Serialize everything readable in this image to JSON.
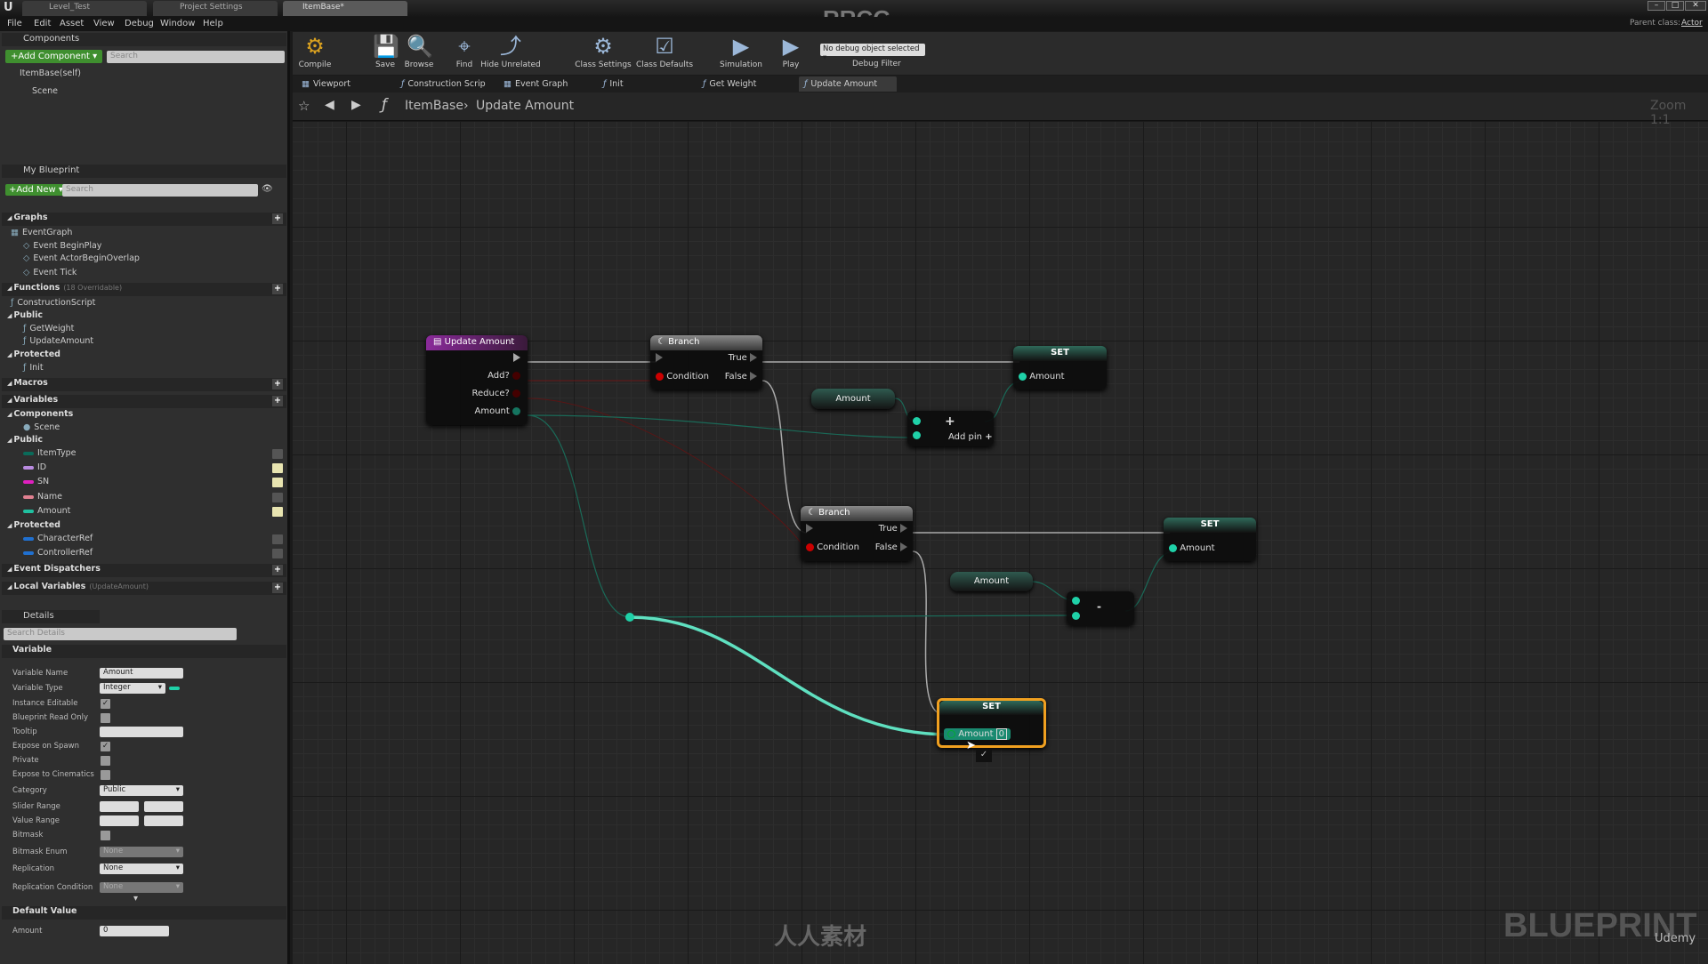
{
  "app": {
    "watermark_title": "RRCG",
    "doc_tabs": [
      "Level_Test",
      "Project Settings",
      "ItemBase*"
    ],
    "menu": [
      "File",
      "Edit",
      "Asset",
      "View",
      "Debug",
      "Window",
      "Help"
    ],
    "parent_class_label": "Parent class:",
    "parent_class": "Actor",
    "window_buttons": [
      "–",
      "□",
      "✕"
    ]
  },
  "components": {
    "title": "Components",
    "add_label": "+Add Component ▾",
    "search_placeholder": "Search",
    "items": [
      "ItemBase(self)",
      "Scene"
    ]
  },
  "my_blueprint": {
    "title": "My Blueprint",
    "add_label": "+Add New ▾",
    "search_placeholder": "Search",
    "rows": [
      {
        "t": "cat",
        "label": "Graphs",
        "plus": true
      },
      {
        "t": "item",
        "label": "EventGraph",
        "indent": 0,
        "icon": "graph-icon"
      },
      {
        "t": "item",
        "label": "Event BeginPlay",
        "indent": 1,
        "icon": "event-icon"
      },
      {
        "t": "item",
        "label": "Event ActorBeginOverlap",
        "indent": 1,
        "icon": "event-icon"
      },
      {
        "t": "item",
        "label": "Event Tick",
        "indent": 1,
        "icon": "event-icon"
      },
      {
        "t": "cat",
        "label": "Functions",
        "note": "(18 Overridable)",
        "plus": true
      },
      {
        "t": "item",
        "label": "ConstructionScript",
        "indent": 0,
        "icon": "function-icon"
      },
      {
        "t": "sub",
        "label": "Public"
      },
      {
        "t": "item",
        "label": "GetWeight",
        "indent": 1,
        "icon": "function-icon"
      },
      {
        "t": "item",
        "label": "UpdateAmount",
        "indent": 1,
        "icon": "function-icon"
      },
      {
        "t": "sub",
        "label": "Protected"
      },
      {
        "t": "item",
        "label": "Init",
        "indent": 1,
        "icon": "function-icon"
      },
      {
        "t": "cat",
        "label": "Macros",
        "plus": true
      },
      {
        "t": "cat",
        "label": "Variables",
        "plus": true
      },
      {
        "t": "sub",
        "label": "Components"
      },
      {
        "t": "item",
        "label": "Scene",
        "indent": 1,
        "icon": "component-icon"
      },
      {
        "t": "sub",
        "label": "Public"
      },
      {
        "t": "var",
        "label": "ItemType",
        "color": "#0a6b5a",
        "eye": false
      },
      {
        "t": "var",
        "label": "ID",
        "color": "#b98be0",
        "eye": true
      },
      {
        "t": "var",
        "label": "SN",
        "color": "#e020c0",
        "eye": true
      },
      {
        "t": "var",
        "label": "Name",
        "color": "#e08090",
        "eye": false
      },
      {
        "t": "var",
        "label": "Amount",
        "color": "#20c0a0",
        "eye": true
      },
      {
        "t": "sub",
        "label": "Protected"
      },
      {
        "t": "var",
        "label": "CharacterRef",
        "color": "#2070d0",
        "eye": false
      },
      {
        "t": "var",
        "label": "ControllerRef",
        "color": "#2070d0",
        "eye": false
      },
      {
        "t": "cat",
        "label": "Event Dispatchers",
        "plus": true
      },
      {
        "t": "cat",
        "label": "Local Variables",
        "note": "(UpdateAmount)",
        "plus": true
      }
    ]
  },
  "details": {
    "title": "Details",
    "search_placeholder": "Search Details",
    "section": "Variable",
    "rows": [
      {
        "label": "Variable Name",
        "kind": "text",
        "value": "Amount"
      },
      {
        "label": "Variable Type",
        "kind": "select",
        "value": "Integer"
      },
      {
        "label": "Instance Editable",
        "kind": "check",
        "checked": true
      },
      {
        "label": "Blueprint Read Only",
        "kind": "check",
        "checked": false
      },
      {
        "label": "Tooltip",
        "kind": "text",
        "value": ""
      },
      {
        "label": "Expose on Spawn",
        "kind": "check",
        "checked": true
      },
      {
        "label": "Private",
        "kind": "check",
        "checked": false
      },
      {
        "label": "Expose to Cinematics",
        "kind": "check",
        "checked": false
      },
      {
        "label": "Category",
        "kind": "select",
        "value": "Public"
      },
      {
        "label": "Slider Range",
        "kind": "range"
      },
      {
        "label": "Value Range",
        "kind": "range"
      },
      {
        "label": "Bitmask",
        "kind": "check",
        "checked": false
      },
      {
        "label": "Bitmask Enum",
        "kind": "select",
        "value": "None",
        "disabled": true
      },
      {
        "label": "Replication",
        "kind": "select",
        "value": "None"
      },
      {
        "label": "Replication Condition",
        "kind": "select",
        "value": "None",
        "disabled": true
      }
    ],
    "default_section": "Default Value",
    "default_label": "Amount",
    "default_value": "0"
  },
  "toolbar": {
    "items": [
      {
        "label": "Compile",
        "icon": "compile-icon",
        "glyph": "⚙"
      },
      {
        "label": "Save",
        "icon": "save-icon",
        "glyph": "💾"
      },
      {
        "label": "Browse",
        "icon": "browse-icon",
        "glyph": "🔍"
      },
      {
        "label": "Find",
        "icon": "find-icon",
        "glyph": "⌖"
      },
      {
        "label": "Hide Unrelated",
        "icon": "hide-unrelated-icon",
        "glyph": "⤴"
      },
      {
        "label": "Class Settings",
        "icon": "class-settings-icon",
        "glyph": "⚙"
      },
      {
        "label": "Class Defaults",
        "icon": "class-defaults-icon",
        "glyph": "☑"
      },
      {
        "label": "Simulation",
        "icon": "simulation-icon",
        "glyph": "▶"
      },
      {
        "label": "Play",
        "icon": "play-icon",
        "glyph": "▶"
      }
    ],
    "debug_select": "No debug object selected ▾",
    "debug_filter": "Debug Filter"
  },
  "graph_tabs": [
    {
      "label": "Viewport",
      "icon": "viewport-icon"
    },
    {
      "label": "Construction Scrip",
      "icon": "function-icon"
    },
    {
      "label": "Event Graph",
      "icon": "graph-icon"
    },
    {
      "label": "Init",
      "icon": "function-icon"
    },
    {
      "label": "Get Weight",
      "icon": "function-icon"
    },
    {
      "label": "Update Amount",
      "icon": "function-icon",
      "active": true
    }
  ],
  "breadcrumb": [
    "ItemBase",
    "Update Amount"
  ],
  "graph": {
    "zoom": "Zoom 1:1",
    "entry": {
      "title": "Update Amount",
      "pins": [
        "Add?",
        "Reduce?",
        "Amount"
      ]
    },
    "branch1": {
      "title": "Branch",
      "true": "True",
      "false": "False",
      "condition": "Condition"
    },
    "branch2": {
      "title": "Branch",
      "true": "True",
      "false": "False",
      "condition": "Condition"
    },
    "set1": {
      "title": "SET",
      "pin": "Amount"
    },
    "set2": {
      "title": "SET",
      "pin": "Amount"
    },
    "set3": {
      "title": "SET",
      "pin": "Amount",
      "value": "0"
    },
    "get1": "Amount",
    "get2": "Amount",
    "add": {
      "symbol": "+",
      "add_pin": "Add pin"
    },
    "sub": {
      "symbol": "-"
    }
  },
  "colors": {
    "int_pin": "#1fd1a8",
    "bool_pin": "#b00000",
    "exec": "#bbbbbb",
    "selected": "#f0a020",
    "function_header": "#7a2a8a"
  },
  "watermark": {
    "bottom_right": "BLUEPRINT",
    "brand": "Udemy",
    "center": "人人素材"
  }
}
